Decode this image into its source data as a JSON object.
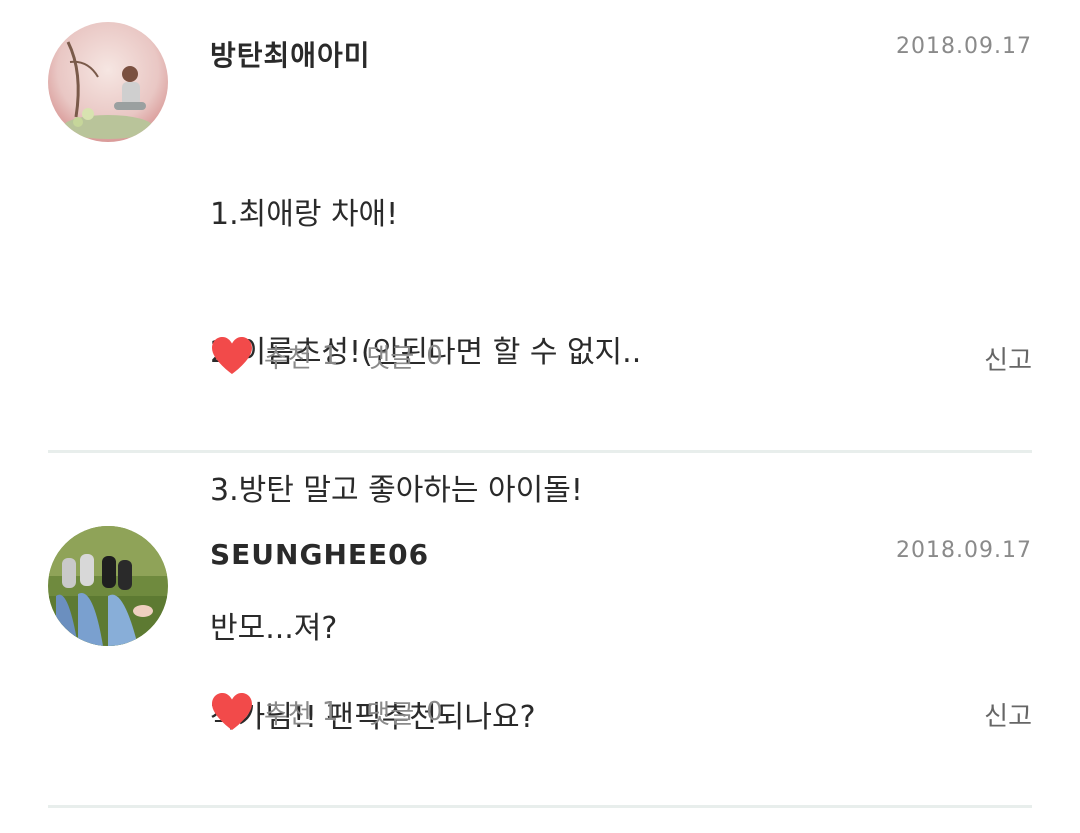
{
  "colors": {
    "heart": "#f24a4a",
    "date": "#8a8a8a",
    "divider": "#e8eeec"
  },
  "comments": [
    {
      "username": "방탄최애아미",
      "date": "2018.09.17",
      "lines": [
        "1.최애랑 차애!",
        "2.이름초성!(안된다면 할 수 없지..",
        "3.방탄 말고 좋아하는 아이돌!",
        "반모...져?"
      ],
      "like_label": "추천",
      "like_count": "1",
      "reply_label": "댓글",
      "reply_count": "0",
      "report_label": "신고",
      "avatar_icon": "profile-photo-flowers"
    },
    {
      "username": "SEUNGHEE06",
      "date": "2018.09.17",
      "lines": [
        "작가님!! 팬픽추천되나요?"
      ],
      "like_label": "추천",
      "like_count": "1",
      "reply_label": "댓글",
      "reply_count": "0",
      "report_label": "신고",
      "avatar_icon": "profile-photo-sneakers"
    }
  ]
}
